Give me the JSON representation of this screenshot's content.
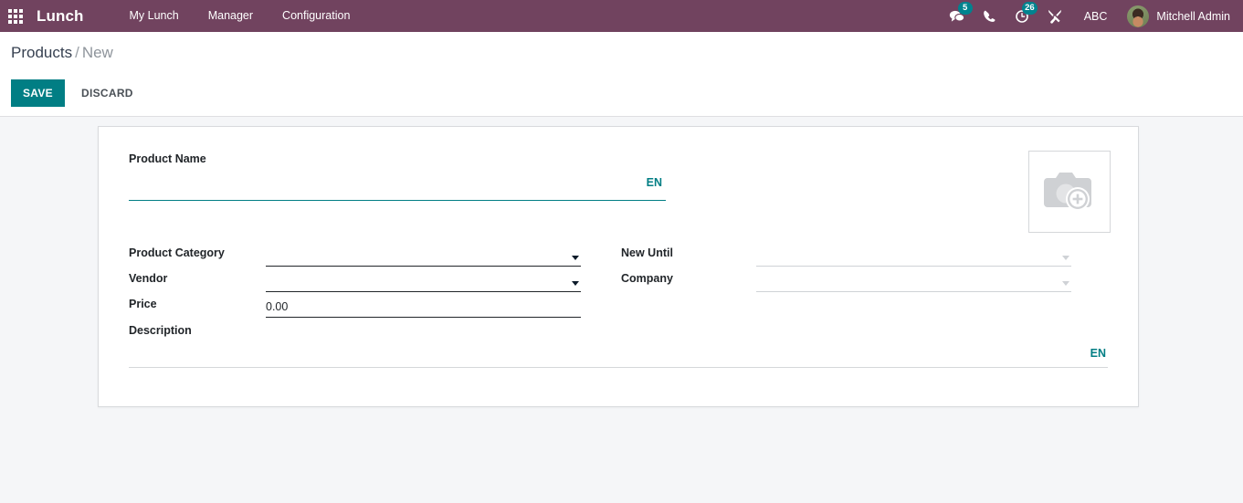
{
  "navbar": {
    "apps_icon": "apps-grid-icon",
    "brand": "Lunch",
    "menu": [
      {
        "label": "My Lunch"
      },
      {
        "label": "Manager"
      },
      {
        "label": "Configuration"
      }
    ],
    "systray": {
      "messages": {
        "icon": "messages-icon",
        "badge": "5"
      },
      "phone": {
        "icon": "phone-icon"
      },
      "activities": {
        "icon": "activities-clock-icon",
        "badge": "26"
      },
      "tools": {
        "icon": "tools-wrench-icon"
      },
      "abc": "ABC",
      "user": "Mitchell Admin"
    }
  },
  "control_panel": {
    "breadcrumb_root": "Products",
    "breadcrumb_sep": "/",
    "breadcrumb_current": "New",
    "save_label": "SAVE",
    "discard_label": "DISCARD"
  },
  "form": {
    "product_name": {
      "label": "Product Name",
      "value": "",
      "placeholder": "",
      "lang_badge": "EN"
    },
    "image": {
      "icon": "camera-add-photo-icon"
    },
    "fields_left": [
      {
        "label": "Product Category",
        "value": "",
        "type": "dropdown",
        "muted": false
      },
      {
        "label": "Vendor",
        "value": "",
        "type": "dropdown",
        "muted": false
      },
      {
        "label": "Price",
        "value": "0.00",
        "type": "text",
        "muted": false
      }
    ],
    "fields_right": [
      {
        "label": "New Until",
        "value": "",
        "type": "dropdown",
        "muted": true
      },
      {
        "label": "Company",
        "value": "",
        "type": "dropdown",
        "muted": true
      }
    ],
    "description": {
      "label": "Description",
      "value": "",
      "placeholder": "",
      "lang_badge": "EN"
    }
  },
  "colors": {
    "navbar": "#71435f",
    "accent_teal": "#017e84",
    "badge_teal": "#00838f",
    "page_bg": "#f5f6f8"
  }
}
